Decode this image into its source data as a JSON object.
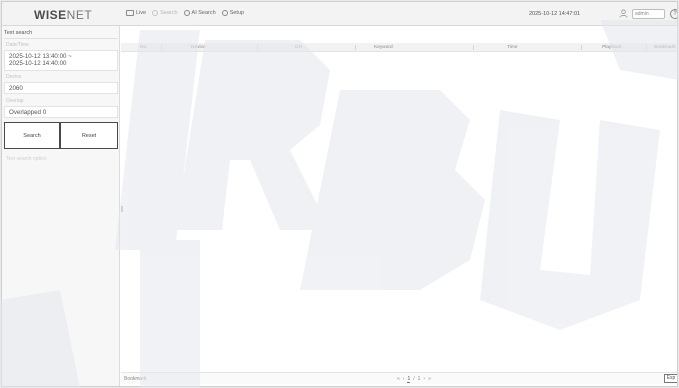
{
  "header": {
    "logo_main": "WISE",
    "logo_accent": "NET",
    "nav": [
      {
        "label": "Live",
        "icon": "monitor-icon",
        "enabled": true
      },
      {
        "label": "Search",
        "icon": "search-icon",
        "enabled": false
      },
      {
        "label": "AI Search",
        "icon": "ai-search-icon",
        "enabled": true
      },
      {
        "label": "Setup",
        "icon": "gear-icon",
        "enabled": true
      }
    ],
    "datetime": "2025-10-12 14:47:01",
    "user": "admin",
    "help_label": "?"
  },
  "sidebar": {
    "title": "Text search",
    "period_label": "Date/Time",
    "period_value_line1": "2025-10-12 13:40:00 ~",
    "period_value_line2": "2025-10-12 14:40:00",
    "channel_label": "Device",
    "channel_value": "2060",
    "overlap_label": "Overlap",
    "overlap_value": "Overlapped 0",
    "search_button": "Search",
    "reset_button": "Reset",
    "extra_link": "Text search option"
  },
  "table": {
    "columns": [
      "No.",
      "Device",
      "CH",
      "Keyword",
      "Time",
      "Playback",
      "Bookmark"
    ]
  },
  "footer": {
    "left_text": "Bookmark",
    "pager": {
      "prev_first": "«",
      "prev": "‹",
      "current": "1",
      "separator": "/",
      "total": "1",
      "next": "›",
      "next_last": "»"
    },
    "export_button": "Exp"
  },
  "watermark": {
    "text": "DISTRIBUTOR",
    "color": "#e7e9ee"
  },
  "colors": {
    "button_border": "#4a4a4a",
    "panel_bg": "#f7f7f7"
  }
}
